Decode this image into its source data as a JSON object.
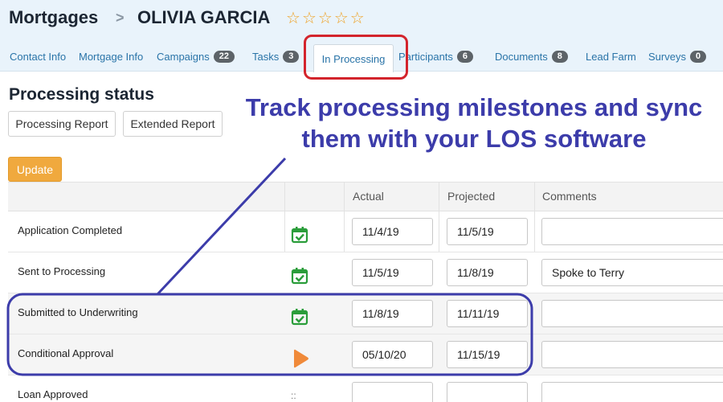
{
  "breadcrumb": {
    "root": "Mortgages",
    "separator": ">",
    "name": "OLIVIA GARCIA"
  },
  "rating": {
    "stars": 5,
    "filled": 0,
    "glyph": "☆"
  },
  "tabs": [
    {
      "label": "Contact Info",
      "badge": null
    },
    {
      "label": "Mortgage Info",
      "badge": null
    },
    {
      "label": "Campaigns",
      "badge": "22"
    },
    {
      "label": "Tasks",
      "badge": "3"
    },
    {
      "label": "In Processing",
      "badge": null,
      "active": true
    },
    {
      "label": "Participants",
      "badge": "6"
    },
    {
      "label": "Documents",
      "badge": "8"
    },
    {
      "label": "Lead Farm",
      "badge": null
    },
    {
      "label": "Surveys",
      "badge": "0"
    }
  ],
  "section": {
    "title": "Processing status",
    "buttons": {
      "processing_report": "Processing Report",
      "extended_report": "Extended Report",
      "update": "Update"
    }
  },
  "overlay": {
    "line1": "Track processing milestones and sync",
    "line2": "them with your LOS software",
    "color": "#3c3caa",
    "highlight_color": "#d3242c"
  },
  "table": {
    "headers": {
      "actual": "Actual",
      "projected": "Projected",
      "comments": "Comments"
    },
    "rows": [
      {
        "label": "Application Completed",
        "status": "calendar-check-icon",
        "actual": "11/4/19",
        "projected": "11/5/19",
        "comment": ""
      },
      {
        "label": "Sent to Processing",
        "status": "calendar-check-icon",
        "actual": "11/5/19",
        "projected": "11/8/19",
        "comment": "Spoke to Terry"
      },
      {
        "label": "Submitted to Underwriting",
        "status": "calendar-check-icon",
        "actual": "11/8/19",
        "projected": "11/11/19",
        "comment": ""
      },
      {
        "label": "Conditional Approval",
        "status": "play-icon",
        "actual": "05/10/20",
        "projected": "11/15/19",
        "comment": ""
      },
      {
        "label": "Loan Approved",
        "status": "drag-handle-icon",
        "drag_glyph": "::",
        "actual": "",
        "projected": "",
        "comment": ""
      }
    ]
  },
  "colors": {
    "accent": "#f0a93e",
    "link": "#2a74a8",
    "check_green": "#2a9d3a",
    "play_orange": "#f08a3a"
  }
}
